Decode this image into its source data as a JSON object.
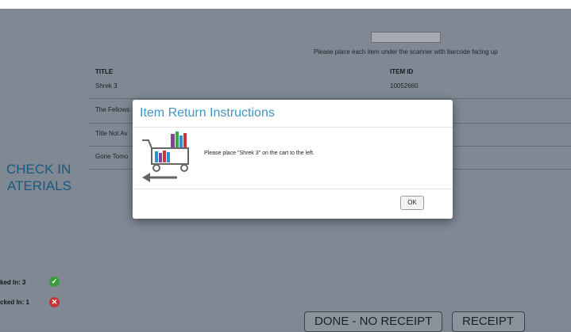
{
  "scanner": {
    "instruction": "Please place each item under the scanner with barcode facing up"
  },
  "table": {
    "headers": [
      "TITLE",
      "ITEM ID"
    ],
    "rows": [
      {
        "title": "Shrek 3",
        "item_id": "10052660"
      },
      {
        "title": "The Fellows",
        "item_id": ""
      },
      {
        "title": "Title Not Av",
        "item_id": ""
      },
      {
        "title": "Gone Tomo",
        "item_id": ""
      }
    ]
  },
  "sidebar": {
    "title_line1": "CHECK IN",
    "title_line2": "ATERIALS",
    "checked_in_label": "ked In: 3",
    "failed_label": "cked In: 1"
  },
  "actions": {
    "done_no_receipt": "DONE - NO RECEIPT",
    "receipt": "RECEIPT"
  },
  "modal": {
    "title": "Item Return Instructions",
    "message": "Please place \"Shrek 3\" on the cart to the left.",
    "ok_label": "OK"
  },
  "icons": {
    "success": "check-circle-icon",
    "error": "x-circle-icon",
    "cart": "book-cart-icon"
  },
  "colors": {
    "accent": "#3d97c2",
    "success": "#3e9a3f",
    "error": "#c63535",
    "overlay": "#7f8893"
  }
}
